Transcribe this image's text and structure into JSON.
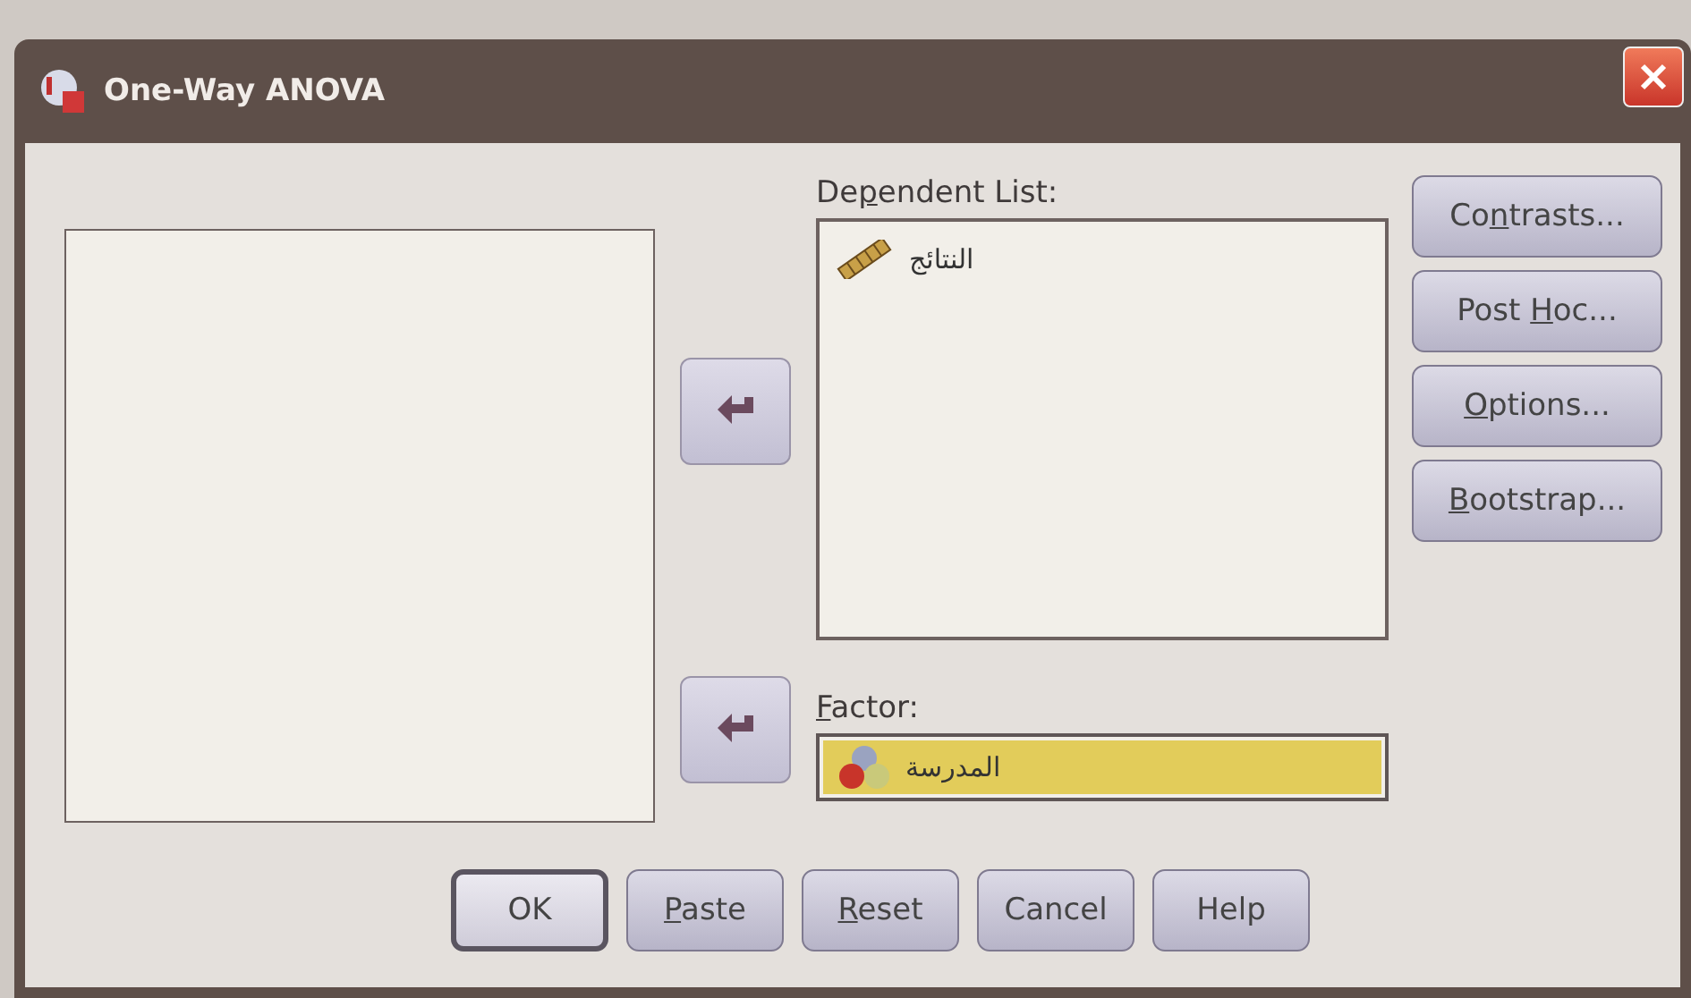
{
  "window": {
    "title": "One-Way ANOVA"
  },
  "dependent_list": {
    "label": {
      "before": "De",
      "key": "p",
      "after": "endent List:"
    },
    "items": [
      {
        "kind": "scale",
        "label": "النتائج"
      }
    ]
  },
  "factor": {
    "label": {
      "key": "F",
      "after": "actor:"
    },
    "value": "المدرسة",
    "kind": "nominal"
  },
  "side_buttons": [
    {
      "label": {
        "before": "Co",
        "key": "n",
        "after": "trasts..."
      }
    },
    {
      "label": {
        "before": "Post ",
        "key": "H",
        "after": "oc..."
      }
    },
    {
      "label": {
        "key": "O",
        "after": "ptions..."
      }
    },
    {
      "label": {
        "key": "B",
        "after": "ootstrap..."
      }
    }
  ],
  "bottom_buttons": [
    {
      "label": {
        "before": "OK"
      },
      "focused": true
    },
    {
      "label": {
        "key": "P",
        "after": "aste"
      },
      "focused": false
    },
    {
      "label": {
        "key": "R",
        "after": "eset"
      },
      "focused": false
    },
    {
      "label": {
        "before": "Cancel"
      },
      "focused": false
    },
    {
      "label": {
        "before": "Help"
      },
      "focused": false
    }
  ]
}
